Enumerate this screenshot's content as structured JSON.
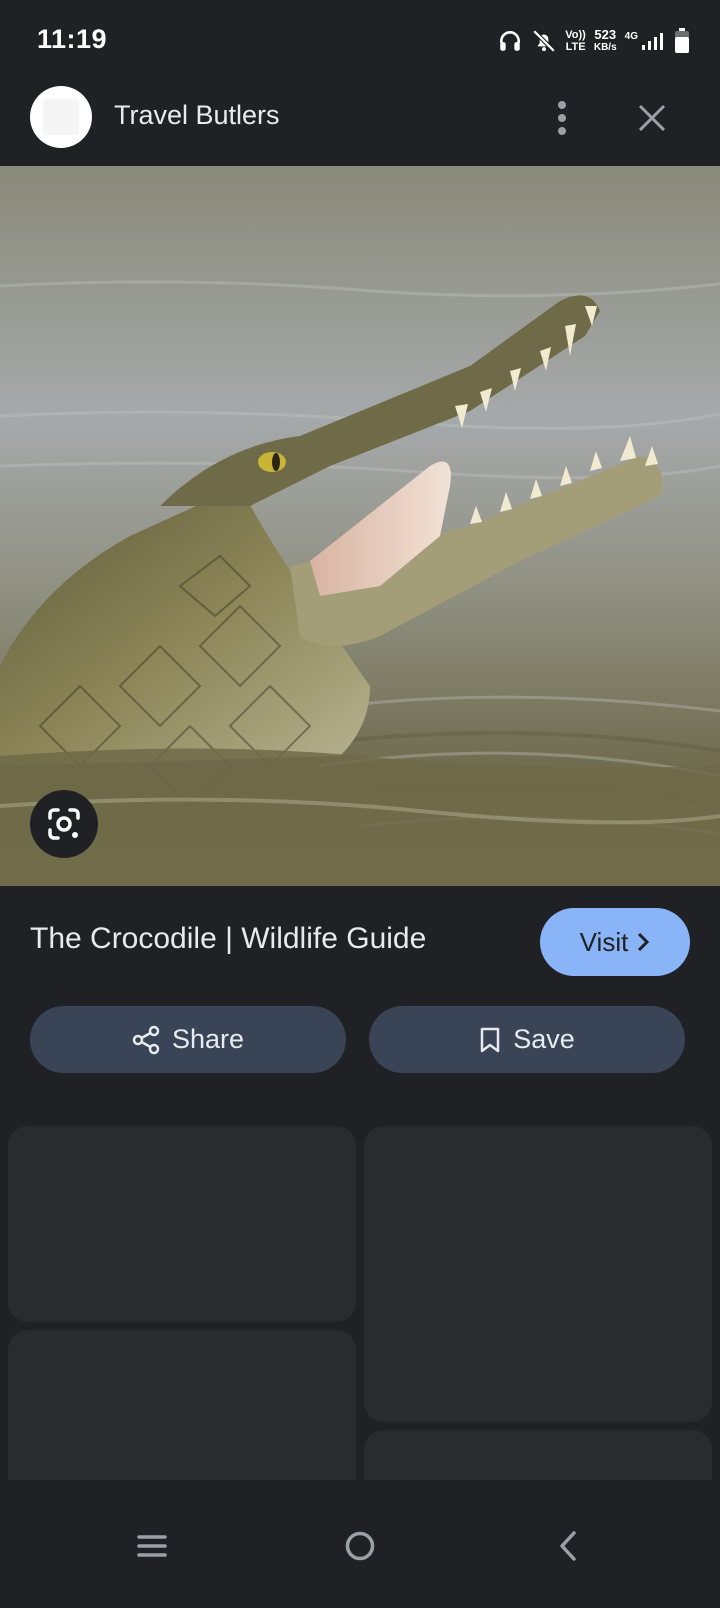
{
  "status_bar": {
    "time": "11:19",
    "net_top": "Vo))",
    "net_bottom": "LTE",
    "speed_value": "523",
    "speed_unit": "KB/s",
    "signal_label": "4G"
  },
  "header": {
    "site_name": "Travel Butlers"
  },
  "result": {
    "title": "The Crocodile | Wildlife Guide",
    "visit_label": "Visit"
  },
  "actions": {
    "share_label": "Share",
    "save_label": "Save"
  },
  "colors": {
    "background": "#202124",
    "accent": "#8ab4f8",
    "button_bg": "#394457",
    "card_bg": "#2a2b2f"
  }
}
